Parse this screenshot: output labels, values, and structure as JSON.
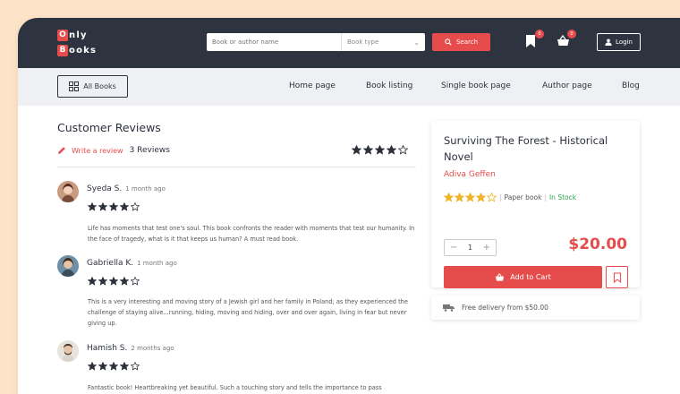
{
  "header": {
    "logo_top_letter": "O",
    "logo_top_rest": "nly",
    "logo_bottom_letter": "B",
    "logo_bottom_rest": "ooks",
    "search_placeholder": "Book or author name",
    "book_type_label": "Book type",
    "search_button": "Search",
    "bookmark_count": "0",
    "cart_count": "0",
    "login_button": "Login",
    "brand_color": "#e74c4c",
    "bar_color": "#2d3440"
  },
  "nav": {
    "all_books": "All Books",
    "links": [
      "Home page",
      "Book listing",
      "Single book page",
      "Author page",
      "Blog"
    ]
  },
  "reviews": {
    "title": "Customer Reviews",
    "write_review": "Write a review",
    "count_label": "3 Reviews",
    "average_rating": 4,
    "items": [
      {
        "name": "Syeda S.",
        "time": "1 month ago",
        "rating": 4,
        "text": "Life has moments that test one's soul. This book confronts the reader with moments that test our humanity. In the face of tragedy, what is it that keeps us human? A must read book."
      },
      {
        "name": "Gabriella K.",
        "time": "1 month ago",
        "rating": 4,
        "text": "This is a very interesting and moving story of a Jewish girl and her family in Poland; as they experienced the challenge of staying alive...running, hiding, moving and hiding, over and over again, living in fear but never giving up."
      },
      {
        "name": "Hamish S.",
        "time": "2 months ago",
        "rating": 4,
        "text": "Fantastic book! Heartbreaking yet beautiful. Such a touching story and tells the importance to pass"
      }
    ]
  },
  "product": {
    "title": "Surviving The Forest - Historical Novel",
    "author": "Adiva Geffen",
    "rating": 4,
    "format": "Paper book",
    "stock": "In Stock",
    "quantity": "1",
    "price": "$20.00",
    "add_to_cart": "Add to Cart"
  },
  "delivery": {
    "text": "Free delivery from $50.00"
  }
}
